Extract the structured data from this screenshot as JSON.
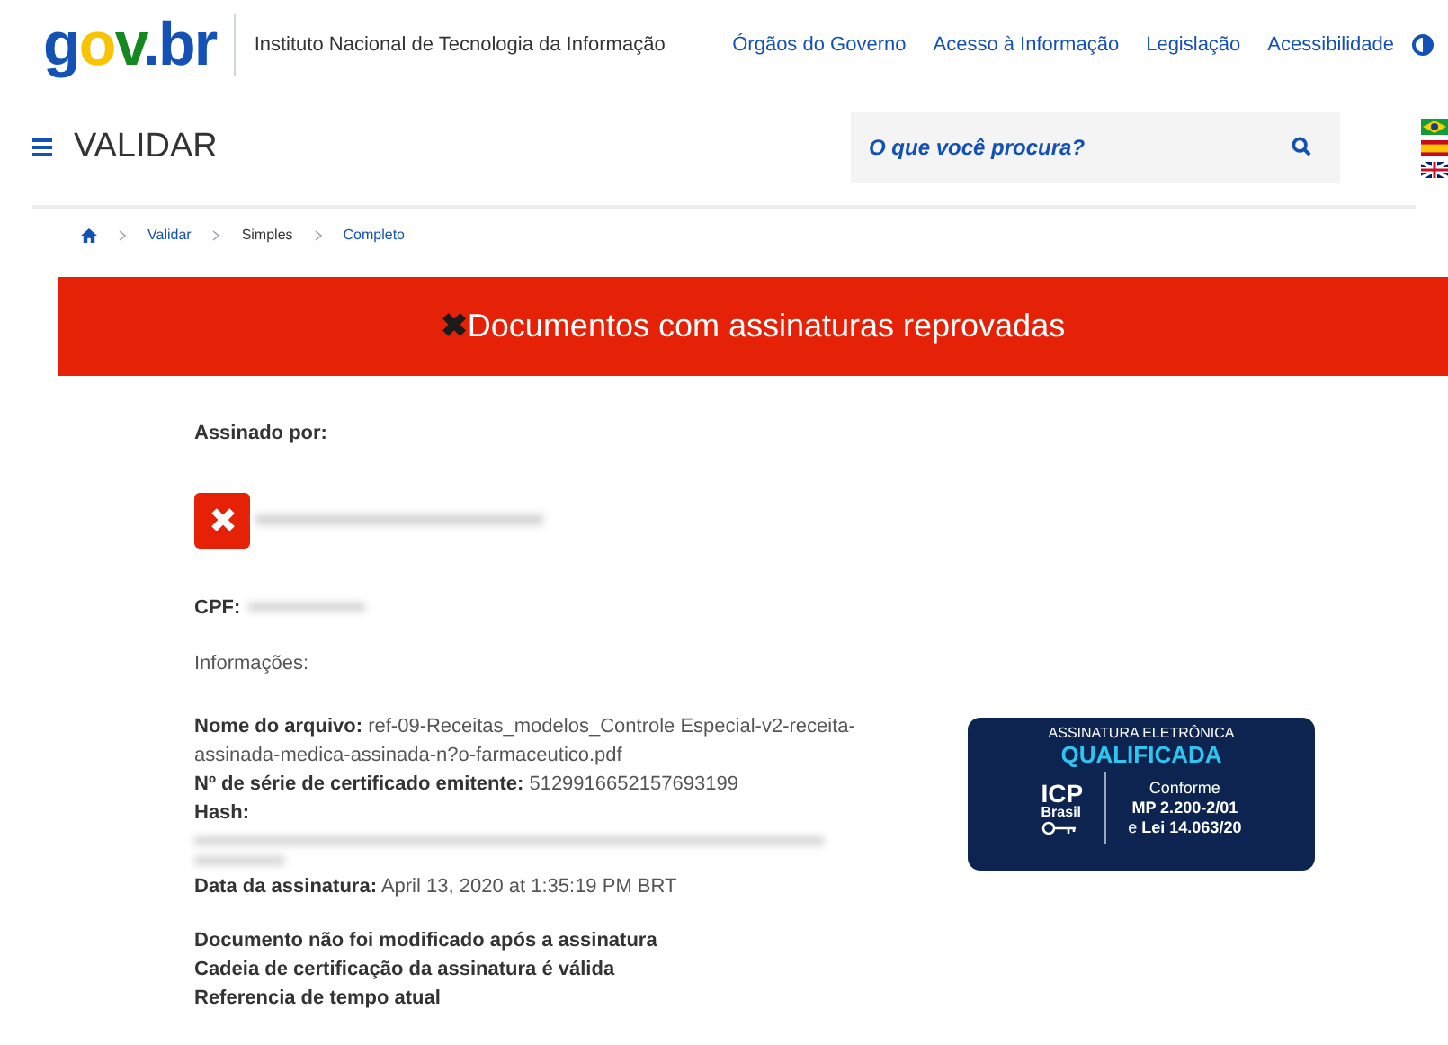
{
  "header": {
    "logo": "gov.br",
    "institution": "Instituto Nacional de Tecnologia da Informação",
    "links": [
      "Órgãos do Governo",
      "Acesso à Informação",
      "Legislação",
      "Acessibilidade"
    ]
  },
  "nav": {
    "title": "VALIDAR",
    "search": {
      "placeholder": "O que você procura?"
    }
  },
  "breadcrumb": [
    "Validar",
    "Simples",
    "Completo"
  ],
  "banner": {
    "icon": "✖",
    "text": "Documentos com assinaturas reprovadas"
  },
  "signer": {
    "heading": "Assinado por:",
    "cpf_label": "CPF:",
    "info_heading": "Informações:"
  },
  "details": [
    {
      "label": "Nome do arquivo:",
      "value": "ref-09-Receitas_modelos_Controle Especial-v2-receita-assinada-medica-assinada-n?o-farmaceutico.pdf"
    },
    {
      "label": "Nº de série de certificado emitente:",
      "value": "5129916652157693199"
    },
    {
      "label": "Hash:"
    },
    {
      "label": "Data da assinatura:",
      "value": "April 13, 2020 at 1:35:19 PM BRT"
    }
  ],
  "checks": [
    "Documento não foi modificado após a assinatura",
    "Cadeia de certificação da assinatura é válida",
    "Referencia de tempo atual"
  ],
  "seal": {
    "line_1": "ASSINATURA ELETRÔNICA",
    "line_2": "QUALIFICADA",
    "brand_1": "ICP",
    "brand_2": "Brasil",
    "text_1": "Conforme",
    "text_2": "MP 2.200-2/01",
    "text_3_prefix": "e",
    "text_3": "Lei 14.063/20"
  }
}
